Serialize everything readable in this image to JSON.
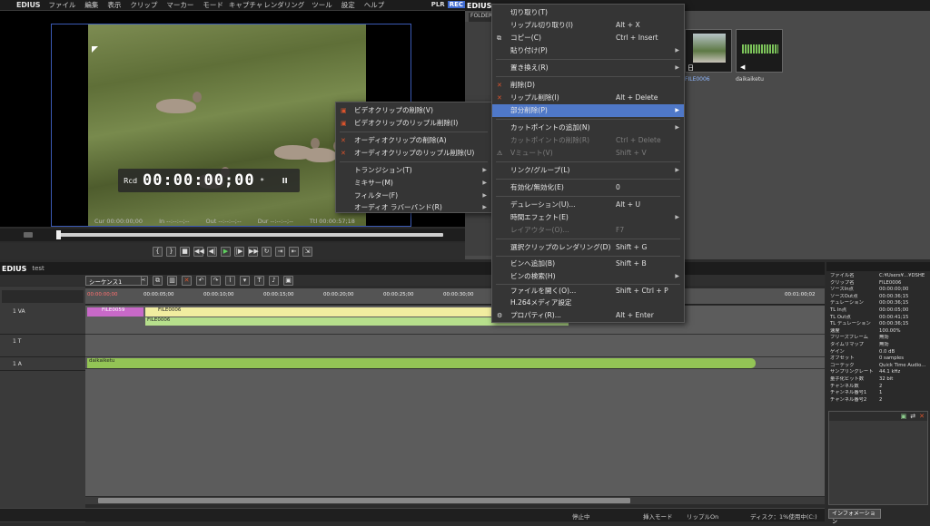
{
  "app": {
    "logo": "EDIUS",
    "menus": [
      "ファイル",
      "編集",
      "表示",
      "クリップ",
      "マーカー",
      "モード",
      "キャプチャ",
      "レンダリング",
      "ツール",
      "設定",
      "ヘルプ"
    ],
    "plr": "PLR",
    "rec": "REC"
  },
  "preview": {
    "rcd_label": "Rcd",
    "timecode": "00:00:00;00",
    "timecode_suffix": "*",
    "pause_glyph": "II",
    "cur": "Cur 00:00:00;00",
    "in": "In --:--:--;--",
    "out": "Out --:--:--;--",
    "dur": "Dur --:--:--;--",
    "ttl": "Ttl 00:00:57;18"
  },
  "bin": {
    "title": "EDIUS",
    "folder_label": "FOLDER",
    "clips": [
      {
        "name": "FILE0006",
        "badge": "日"
      },
      {
        "name": "daikaiketu",
        "badge": "◀"
      }
    ]
  },
  "timeline": {
    "title": "EDIUS",
    "project": "test",
    "sequence_tab": "シーケンス1",
    "ruler": [
      "00:00:00;00",
      "00:00:05;00",
      "00:00:10;00",
      "00:00:15;00",
      "00:00:20;00",
      "00:00:25;00",
      "00:00:30;00",
      "00:01:00;02"
    ],
    "tracks": [
      {
        "label": "1 VA"
      },
      {
        "label": "1 T"
      },
      {
        "label": "1 A"
      }
    ],
    "clips": {
      "v1": "FILE0059",
      "v2": "FILE0006",
      "a_sub": "FILE0006",
      "audio": "daikaiketu"
    }
  },
  "status": {
    "state": "停止中",
    "insert_mode": "挿入モード",
    "ripple": "リップルOn",
    "disk": "ディスク：1%使用中(C:)"
  },
  "info_panel": {
    "rows": [
      {
        "k": "ファイル名",
        "v": "C:¥Users¥...¥DSHE"
      },
      {
        "k": "クリップ名",
        "v": "FILE0006"
      },
      {
        "k": "ソースIn点",
        "v": "00:00:00;00"
      },
      {
        "k": "ソースOut点",
        "v": "00:00:36;15"
      },
      {
        "k": "デュレーション",
        "v": "00:00:36;15"
      },
      {
        "k": "TL In点",
        "v": "00:00:05;00"
      },
      {
        "k": "TL Out点",
        "v": "00:00:41;15"
      },
      {
        "k": "TL デュレーション",
        "v": "00:00:36;15"
      },
      {
        "k": "速度",
        "v": "100.00%"
      },
      {
        "k": "フリーズフレーム",
        "v": "無効"
      },
      {
        "k": "タイムリマップ",
        "v": "無効"
      },
      {
        "k": "ゲイン",
        "v": "0.0 dB"
      },
      {
        "k": "オフセット",
        "v": "0 samples"
      },
      {
        "k": "コーデック",
        "v": "Quick Time Audio..."
      },
      {
        "k": "サンプリングレート",
        "v": "44.1 kHz"
      },
      {
        "k": "量子化ビット数",
        "v": "32 bit"
      },
      {
        "k": "チャンネル数",
        "v": "2"
      },
      {
        "k": "チャンネル番号1",
        "v": "1"
      },
      {
        "k": "チャンネル番号2",
        "v": "2"
      }
    ],
    "tab": "インフォメーション"
  },
  "context_menu": {
    "items": [
      {
        "label": "切り取り(T)",
        "shortcut": ""
      },
      {
        "label": "リップル切り取り(I)",
        "shortcut": "Alt + X"
      },
      {
        "label": "コピー(C)",
        "shortcut": "Ctrl + Insert"
      },
      {
        "label": "貼り付け(P)",
        "shortcut": ""
      },
      {
        "label": "置き換え(R)",
        "shortcut": ""
      },
      {
        "label": "削除(D)",
        "shortcut": ""
      },
      {
        "label": "リップル削除(I)",
        "shortcut": "Alt + Delete"
      },
      {
        "label": "部分削除(P)",
        "shortcut": ""
      },
      {
        "label": "カットポイントの追加(N)",
        "shortcut": ""
      },
      {
        "label": "カットポイントの削除(R)",
        "shortcut": "Ctrl + Delete"
      },
      {
        "label": "Vミュート(V)",
        "shortcut": "Shift + V"
      },
      {
        "label": "リンク/グループ(L)",
        "shortcut": ""
      },
      {
        "label": "有効化/無効化(E)",
        "shortcut": "0"
      },
      {
        "label": "デュレーション(U)...",
        "shortcut": "Alt + U"
      },
      {
        "label": "時間エフェクト(E)",
        "shortcut": ""
      },
      {
        "label": "レイアウター(O)...",
        "shortcut": "F7"
      },
      {
        "label": "選択クリップのレンダリング(D)",
        "shortcut": "Shift + G"
      },
      {
        "label": "ビンへ追加(B)",
        "shortcut": "Shift + B"
      },
      {
        "label": "ビンの検索(H)",
        "shortcut": ""
      },
      {
        "label": "ファイルを開く(O)...",
        "shortcut": "Shift + Ctrl + P"
      },
      {
        "label": "H.264メディア設定",
        "shortcut": ""
      },
      {
        "label": "プロパティ(R)...",
        "shortcut": "Alt + Enter"
      }
    ]
  },
  "submenu": {
    "items": [
      {
        "label": "ビデオクリップの削除(V)"
      },
      {
        "label": "ビデオクリップのリップル削除(I)"
      },
      {
        "label": "オーディオクリップの削除(A)"
      },
      {
        "label": "オーディオクリップのリップル削除(U)"
      },
      {
        "label": "トランジション(T)"
      },
      {
        "label": "ミキサー(M)"
      },
      {
        "label": "フィルター(F)"
      },
      {
        "label": "オーディオ ラバーバンド(R)"
      }
    ]
  },
  "colors": {
    "accent": "#4f78c8",
    "clip_video": "#f1eda0",
    "clip_title": "#c869c8",
    "clip_audio": "#93c455",
    "rec": "#3e6ad0"
  }
}
